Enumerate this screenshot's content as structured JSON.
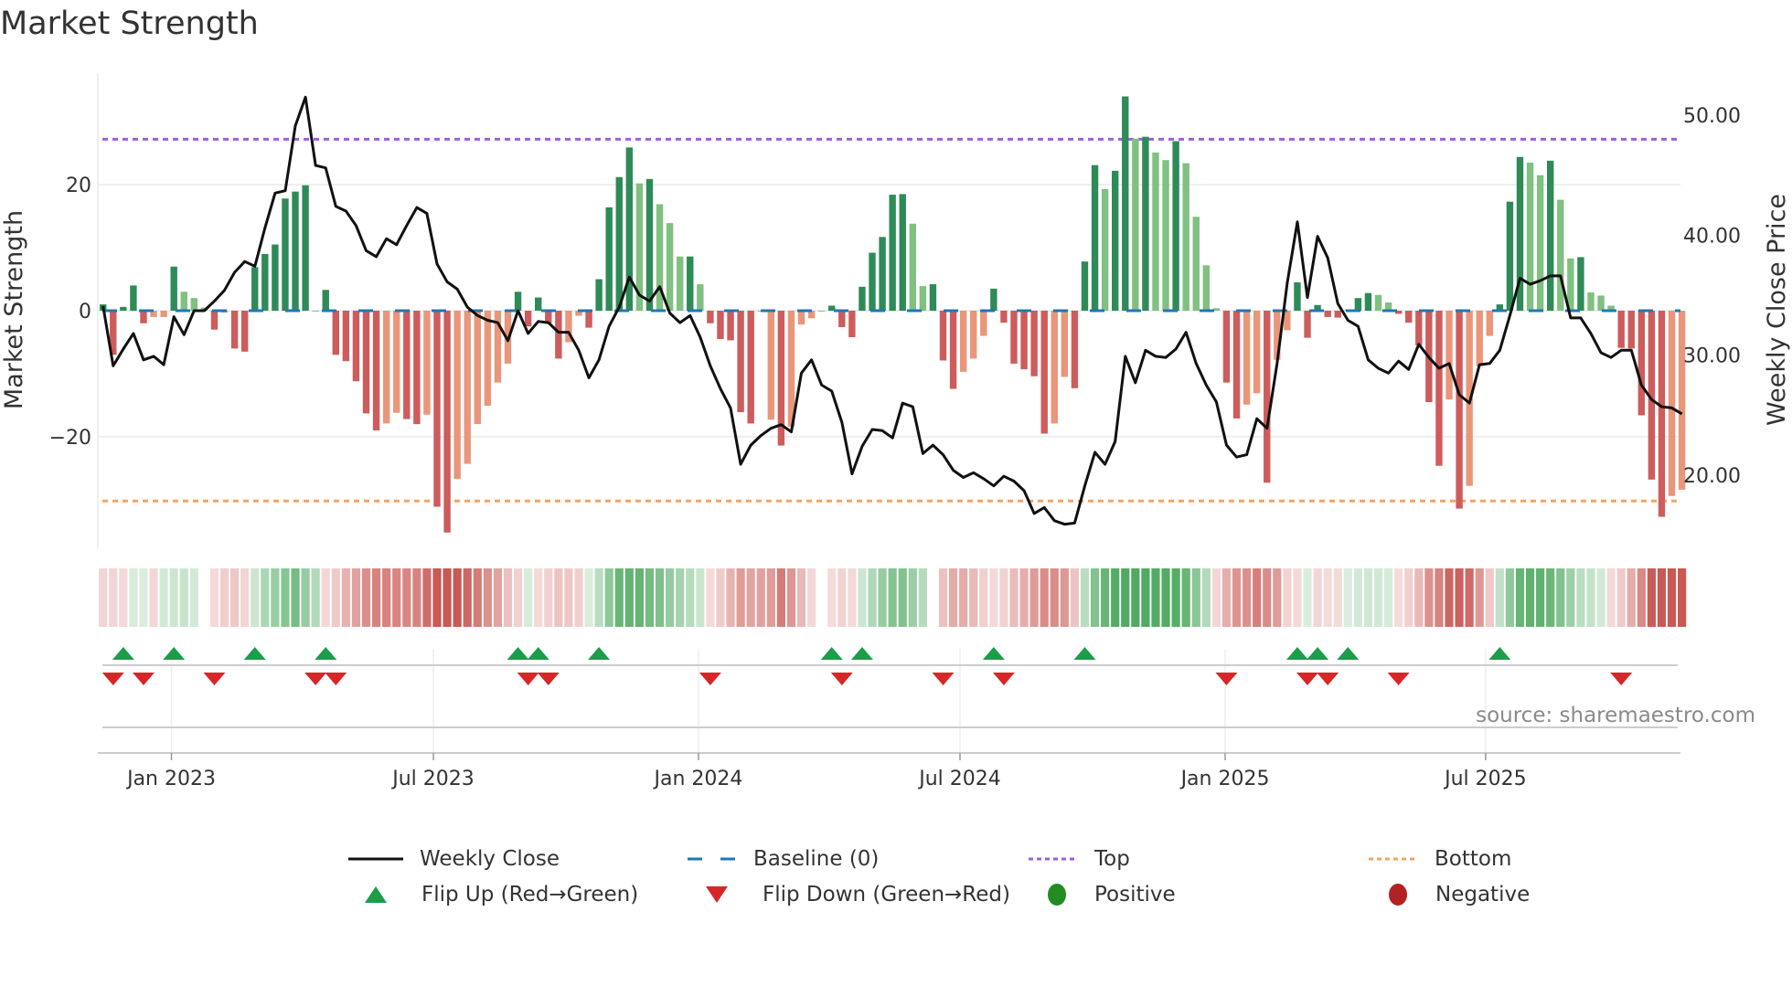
{
  "title": "Market Strength",
  "source": "source: sharemaestro.com",
  "legend": {
    "weekly_close": "Weekly Close",
    "baseline": "Baseline (0)",
    "top": "Top",
    "bottom": "Bottom",
    "flip_up": "Flip Up (Red→Green)",
    "flip_down": "Flip Down (Green→Red)",
    "positive": "Positive",
    "negative": "Negative"
  },
  "colors": {
    "pos_dark": "#2e8b57",
    "pos_light": "#80c080",
    "neg_dark": "#cd5c5c",
    "neg_light": "#e9967a",
    "baseline": "#1f77b4",
    "top": "#9b5fe0",
    "bottom": "#f4a460",
    "close": "#111111",
    "flip_up": "#1a9e4a",
    "flip_down": "#d62728",
    "positive": "#228b22",
    "negative": "#b22222"
  },
  "chart_data": {
    "type": "bar+line",
    "title": "Market Strength",
    "ylabel": "Market Strength",
    "y2label": "Weekly Close Price",
    "ylim": [
      -37.7,
      37.7
    ],
    "y2lim": [
      13.9,
      53.5
    ],
    "yticks": [
      {
        "v": 20,
        "label": "20"
      },
      {
        "v": 0,
        "label": "0"
      },
      {
        "v": -20,
        "label": "−20"
      }
    ],
    "y2ticks": [
      {
        "v": 50,
        "label": "50.00"
      },
      {
        "v": 40,
        "label": "40.00"
      },
      {
        "v": 30,
        "label": "30.00"
      },
      {
        "v": 20,
        "label": "20.00"
      }
    ],
    "xticks": [
      {
        "week": 6.76,
        "label": "Jan 2023"
      },
      {
        "week": 32.64,
        "label": "Jul 2023"
      },
      {
        "week": 58.83,
        "label": "Jan 2024"
      },
      {
        "week": 84.67,
        "label": "Jul 2024"
      },
      {
        "week": 110.87,
        "label": "Jan 2025"
      },
      {
        "week": 136.6,
        "label": "Jul 2025"
      }
    ],
    "top_level": 27.2,
    "bottom_level": -30.2,
    "strength": [
      1,
      -7,
      0.6,
      4,
      -2,
      -1,
      -1,
      7,
      3,
      2,
      0.5,
      -3,
      -0.3,
      -6,
      -6.5,
      6.9,
      9,
      10.5,
      17.8,
      18.9,
      19.9,
      0,
      3.3,
      -7,
      -8,
      -11.2,
      -16.3,
      -19,
      -17.9,
      -16.2,
      -17.2,
      -18,
      -16.5,
      -31.1,
      -35.2,
      -26.7,
      -24.3,
      -18,
      -15.1,
      -11.4,
      -8.4,
      3,
      -2.5,
      2.1,
      -2,
      -7.6,
      -5,
      -0.8,
      -2.7,
      5,
      16.4,
      21.2,
      25.9,
      20.2,
      20.9,
      16.9,
      13.9,
      8.6,
      8.6,
      4.2,
      -2,
      -4.5,
      -4.7,
      -16.1,
      -17.9,
      0,
      -17.3,
      -21.4,
      -18.4,
      -2.2,
      -1.2,
      0,
      0.8,
      -2.6,
      -4.2,
      3.8,
      9.2,
      11.7,
      18.4,
      18.5,
      13.8,
      3.9,
      4.2,
      -7.9,
      -12.4,
      -9.7,
      -7.6,
      -4,
      3.5,
      -1.9,
      -8.4,
      -9.3,
      -10.4,
      -19.5,
      -17.9,
      -10.5,
      -12.3,
      7.8,
      23.1,
      19.3,
      22.2,
      34,
      27.3,
      27.6,
      25.1,
      23.9,
      26.9,
      23.4,
      14.9,
      7.2,
      0.4,
      -11.4,
      -17.1,
      -14.9,
      -13.1,
      -27.3,
      -7.8,
      -3.1,
      4.5,
      -4.3,
      0.9,
      -1,
      -1.1,
      0.2,
      2,
      2.8,
      2.5,
      1.3,
      -0.5,
      -1.9,
      -5.5,
      -14.5,
      -24.6,
      -14.1,
      -31.4,
      -27.8,
      -8.8,
      -4,
      1,
      17.3,
      24.4,
      23.5,
      21.5,
      23.8,
      17.6,
      8.3,
      8.5,
      2.9,
      2.4,
      0.8,
      -5.9,
      -6,
      -16.6,
      -26.8,
      -32.7,
      -29.4,
      -28.4
    ],
    "light_shade_weeks": [
      5,
      6,
      8,
      9,
      10,
      12,
      28,
      29,
      32,
      35,
      36,
      37,
      38,
      39,
      40,
      46,
      47,
      53,
      55,
      56,
      57,
      59,
      66,
      68,
      69,
      70,
      80,
      81,
      85,
      86,
      87,
      94,
      95,
      99,
      102,
      104,
      105,
      107,
      108,
      109,
      110,
      113,
      114,
      116,
      117,
      123,
      126,
      127,
      133,
      135,
      136,
      137,
      141,
      142,
      144,
      145,
      147,
      148,
      149,
      155,
      156
    ],
    "close": [
      34.1,
      29.1,
      30.5,
      31.8,
      29.6,
      29.9,
      29.2,
      33.2,
      31.7,
      33.7,
      33.7,
      34.5,
      35.4,
      36.9,
      37.8,
      37.4,
      40.6,
      43.5,
      43.7,
      49.1,
      51.5,
      45.8,
      45.6,
      42.4,
      42.0,
      40.8,
      38.7,
      38.2,
      39.7,
      39.2,
      40.8,
      42.3,
      41.8,
      37.6,
      36.1,
      35.5,
      34.0,
      33.3,
      32.9,
      32.7,
      31.2,
      33.7,
      31.8,
      32.8,
      32.7,
      31.9,
      31.9,
      30.4,
      28.1,
      29.6,
      32.4,
      34.0,
      36.5,
      35.0,
      34.5,
      35.7,
      33.5,
      32.7,
      33.3,
      31.5,
      29.1,
      27.2,
      25.6,
      20.9,
      22.5,
      23.3,
      23.9,
      24.2,
      23.6,
      28.5,
      29.6,
      27.5,
      27.0,
      24.4,
      20.1,
      22.4,
      23.8,
      23.7,
      23.1,
      26.0,
      25.7,
      21.8,
      22.5,
      21.7,
      20.4,
      19.8,
      20.2,
      19.7,
      19.1,
      19.9,
      19.5,
      18.7,
      16.8,
      17.3,
      16.2,
      15.9,
      16.0,
      19.1,
      21.9,
      20.9,
      22.8,
      29.9,
      27.7,
      30.4,
      29.9,
      29.8,
      30.5,
      31.9,
      29.3,
      27.5,
      26.1,
      22.5,
      21.5,
      21.7,
      24.7,
      23.9,
      29.3,
      36.0,
      41.1,
      34.8,
      39.9,
      38.1,
      34.3,
      32.9,
      32.4,
      29.6,
      28.9,
      28.5,
      29.5,
      28.8,
      30.9,
      29.8,
      28.9,
      29.3,
      26.7,
      26.0,
      29.2,
      29.3,
      30.4,
      33.3,
      36.4,
      35.9,
      36.2,
      36.6,
      36.6,
      33.1,
      33.1,
      31.8,
      30.2,
      29.8,
      30.4,
      30.4,
      27.5,
      26.3,
      25.7,
      25.6,
      25.1
    ],
    "flip_up_weeks": [
      2,
      7,
      15,
      22,
      41,
      43,
      49,
      72,
      75,
      88,
      97,
      118,
      120,
      123,
      138
    ],
    "flip_down_weeks": [
      1,
      4,
      11,
      21,
      23,
      42,
      44,
      60,
      73,
      83,
      89,
      111,
      119,
      121,
      128,
      150
    ],
    "legend_position": "bottom"
  }
}
